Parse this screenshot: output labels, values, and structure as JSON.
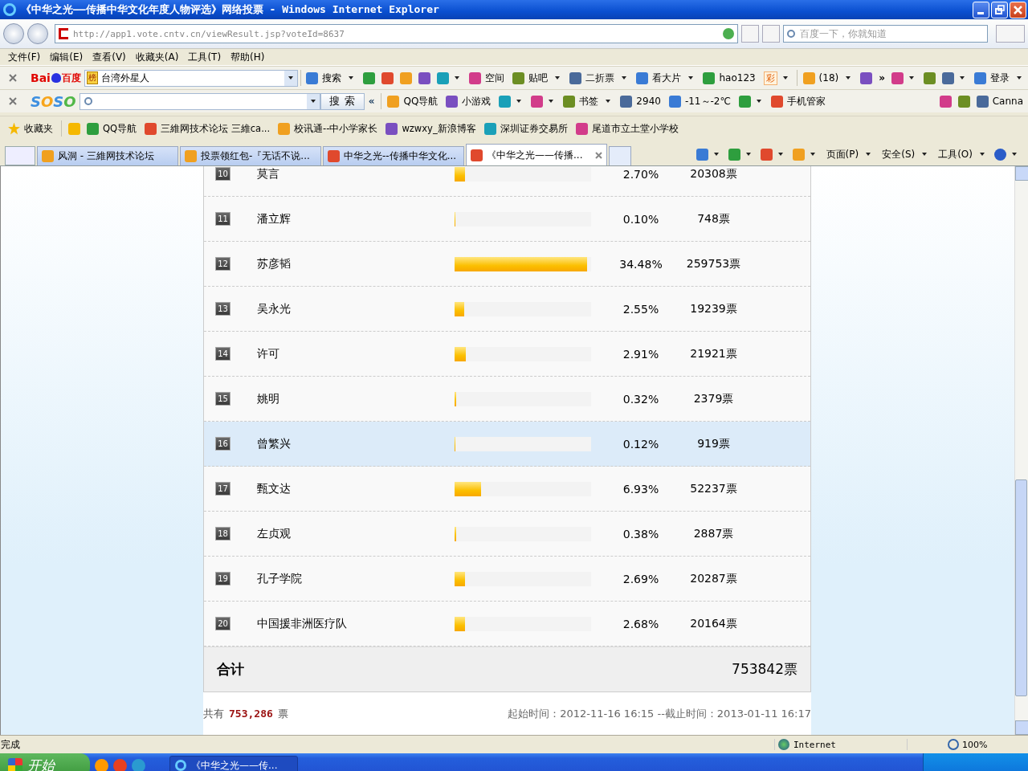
{
  "window": {
    "title": "《中华之光——传播中华文化年度人物评选》网络投票 - Windows Internet Explorer"
  },
  "address_bar": {
    "url": "http://app1.vote.cntv.cn/viewResult.jsp?voteId=8637"
  },
  "search_box": {
    "placeholder": "百度一下，你就知道"
  },
  "menu_bar": [
    "文件(F)",
    "编辑(E)",
    "查看(V)",
    "收藏夹(A)",
    "工具(T)",
    "帮助(H)"
  ],
  "baidu_toolbar": {
    "logo": [
      "Bai",
      "百度"
    ],
    "badge": "榜",
    "search_value": "台湾外星人",
    "items": [
      {
        "kind": "button",
        "label": "搜索",
        "dropdown": true
      },
      {
        "kind": "icon",
        "dropdown": false
      },
      {
        "kind": "icon",
        "dropdown": false
      },
      {
        "kind": "icon",
        "dropdown": false
      },
      {
        "kind": "icon",
        "dropdown": false
      },
      {
        "kind": "icon",
        "dropdown": true
      },
      {
        "kind": "button",
        "label": "空间",
        "dropdown": false
      },
      {
        "kind": "button",
        "label": "贴吧",
        "dropdown": true
      },
      {
        "kind": "button",
        "label": "二折票",
        "dropdown": true
      },
      {
        "kind": "button",
        "label": "看大片",
        "dropdown": true
      },
      {
        "kind": "button",
        "label": "hao123",
        "dropdown": false
      },
      {
        "kind": "badge",
        "label": "彩",
        "dropdown": true
      },
      {
        "kind": "button",
        "label": "(18)",
        "dropdown": true
      },
      {
        "kind": "icon",
        "dropdown": false
      },
      {
        "kind": "chevron",
        "label": "»"
      },
      {
        "kind": "icon",
        "dropdown": true
      },
      {
        "kind": "icon",
        "dropdown": false
      },
      {
        "kind": "icon",
        "dropdown": true
      },
      {
        "kind": "button",
        "label": "登录",
        "dropdown": true
      }
    ]
  },
  "soso_toolbar": {
    "logo": "SOSO",
    "search_button": "搜 索",
    "collapse": "«",
    "items": [
      {
        "kind": "button",
        "label": "QQ导航",
        "dropdown": false
      },
      {
        "kind": "button",
        "label": "小游戏",
        "dropdown": false
      },
      {
        "kind": "icon",
        "dropdown": true
      },
      {
        "kind": "icon",
        "dropdown": true
      },
      {
        "kind": "button",
        "label": "书签",
        "dropdown": true
      },
      {
        "kind": "button",
        "label": "2940",
        "dropdown": false
      },
      {
        "kind": "button",
        "label": "-11～-2℃",
        "dropdown": false
      },
      {
        "kind": "icon",
        "dropdown": true
      },
      {
        "kind": "button",
        "label": "手机管家",
        "dropdown": false
      }
    ],
    "right_items": [
      {
        "kind": "icon",
        "dropdown": false
      },
      {
        "kind": "icon",
        "dropdown": false
      },
      {
        "kind": "button",
        "label": "Canna",
        "dropdown": false
      }
    ]
  },
  "favorites_bar": {
    "label": "收藏夹",
    "items": [
      "QQ导航",
      "三維网技术论坛 三維ca...",
      "校讯通--中小学家长",
      "wzwxy_新浪博客",
      "深圳证券交易所",
      "尾道市立土堂小学校"
    ]
  },
  "tabs": [
    {
      "label": "风洞 - 三維网技术论坛",
      "selected": false
    },
    {
      "label": "投票领红包-『无话不说...",
      "selected": false
    },
    {
      "label": "中华之光--传播中华文化...",
      "selected": false
    },
    {
      "label": "《中华之光——传播...",
      "selected": true
    }
  ],
  "command_bar": [
    "页面(P)",
    "安全(S)",
    "工具(O)"
  ],
  "vote": {
    "rows": [
      {
        "rank": "10",
        "name": "莫言",
        "level": 0.076,
        "percent": "2.70%",
        "votes": "20308票",
        "selected": false
      },
      {
        "rank": "11",
        "name": "潘立辉",
        "level": 0.004,
        "percent": "0.10%",
        "votes": "748票",
        "selected": false
      },
      {
        "rank": "12",
        "name": "苏彦韬",
        "level": 0.969,
        "percent": "34.48%",
        "votes": "259753票",
        "selected": false
      },
      {
        "rank": "13",
        "name": "吴永光",
        "level": 0.072,
        "percent": "2.55%",
        "votes": "19239票",
        "selected": false
      },
      {
        "rank": "14",
        "name": "许可",
        "level": 0.082,
        "percent": "2.91%",
        "votes": "21921票",
        "selected": false
      },
      {
        "rank": "15",
        "name": "姚明",
        "level": 0.009,
        "percent": "0.32%",
        "votes": "2379票",
        "selected": false
      },
      {
        "rank": "16",
        "name": "曾繁兴",
        "level": 0.004,
        "percent": "0.12%",
        "votes": "919票",
        "selected": true
      },
      {
        "rank": "17",
        "name": "甄文达",
        "level": 0.195,
        "percent": "6.93%",
        "votes": "52237票",
        "selected": false
      },
      {
        "rank": "18",
        "name": "左贞观",
        "level": 0.011,
        "percent": "0.38%",
        "votes": "2887票",
        "selected": false
      },
      {
        "rank": "19",
        "name": "孔子学院",
        "level": 0.076,
        "percent": "2.69%",
        "votes": "20287票",
        "selected": false
      },
      {
        "rank": "20",
        "name": "中国援非洲医疗队",
        "level": 0.075,
        "percent": "2.68%",
        "votes": "20164票",
        "selected": false
      }
    ],
    "total_label": "合计",
    "total": "753842票",
    "summary": {
      "prefix": "共有",
      "count": "753,286",
      "suffix": "票",
      "period": "起始时间：2012-11-16 16:15 --截止时间：2013-01-11 16:17"
    }
  },
  "status_bar": {
    "text": "完成",
    "zone": "Internet",
    "zoom": "100%"
  },
  "taskbar": {
    "start": "开始",
    "window": "《中华之光——传..."
  }
}
